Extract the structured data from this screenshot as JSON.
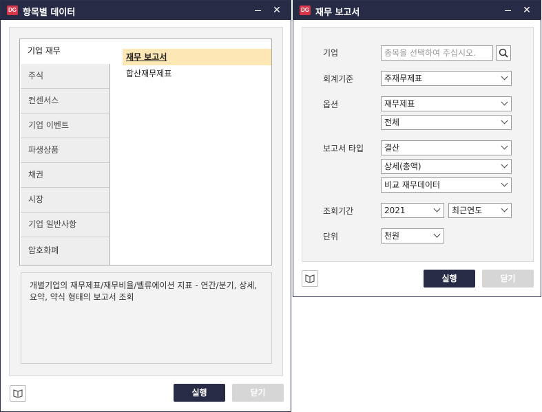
{
  "left_window": {
    "title": "항목별 데이터",
    "categories": [
      {
        "label": "기업 재무"
      },
      {
        "label": "주식"
      },
      {
        "label": "컨센서스"
      },
      {
        "label": "기업 이벤트"
      },
      {
        "label": "파생상품"
      },
      {
        "label": "채권"
      },
      {
        "label": "시장"
      },
      {
        "label": "기업 일반사항"
      },
      {
        "label": "암호화폐"
      }
    ],
    "items": [
      {
        "label": "재무 보고서"
      },
      {
        "label": "합산재무제표"
      }
    ],
    "description": "개별기업의 재무제표/재무비율/벨류에이션 지표 - 연간/분기, 상세, 요약, 약식 형태의 보고서 조회",
    "run_label": "실행",
    "close_label": "닫기"
  },
  "right_window": {
    "title": "재무 보고서",
    "company_label": "기업",
    "company_placeholder": "종목을 선택하여 주십시오.",
    "accounting_label": "회계기준",
    "accounting_value": "주재무제표",
    "option_label": "옵션",
    "option_value_1": "재무제표",
    "option_value_2": "전체",
    "report_type_label": "보고서 타입",
    "report_type_1": "결산",
    "report_type_2": "상세(총액)",
    "report_type_3": "비교 재무데이터",
    "period_label": "조회기간",
    "period_year": "2021",
    "period_mode": "최근연도",
    "unit_label": "단위",
    "unit_value": "천원",
    "run_label": "실행",
    "close_label": "닫기"
  },
  "logo_text": "DG",
  "colors": {
    "titlebar": "#272b46",
    "accent": "#d8354a",
    "selected": "#fde7b4"
  }
}
